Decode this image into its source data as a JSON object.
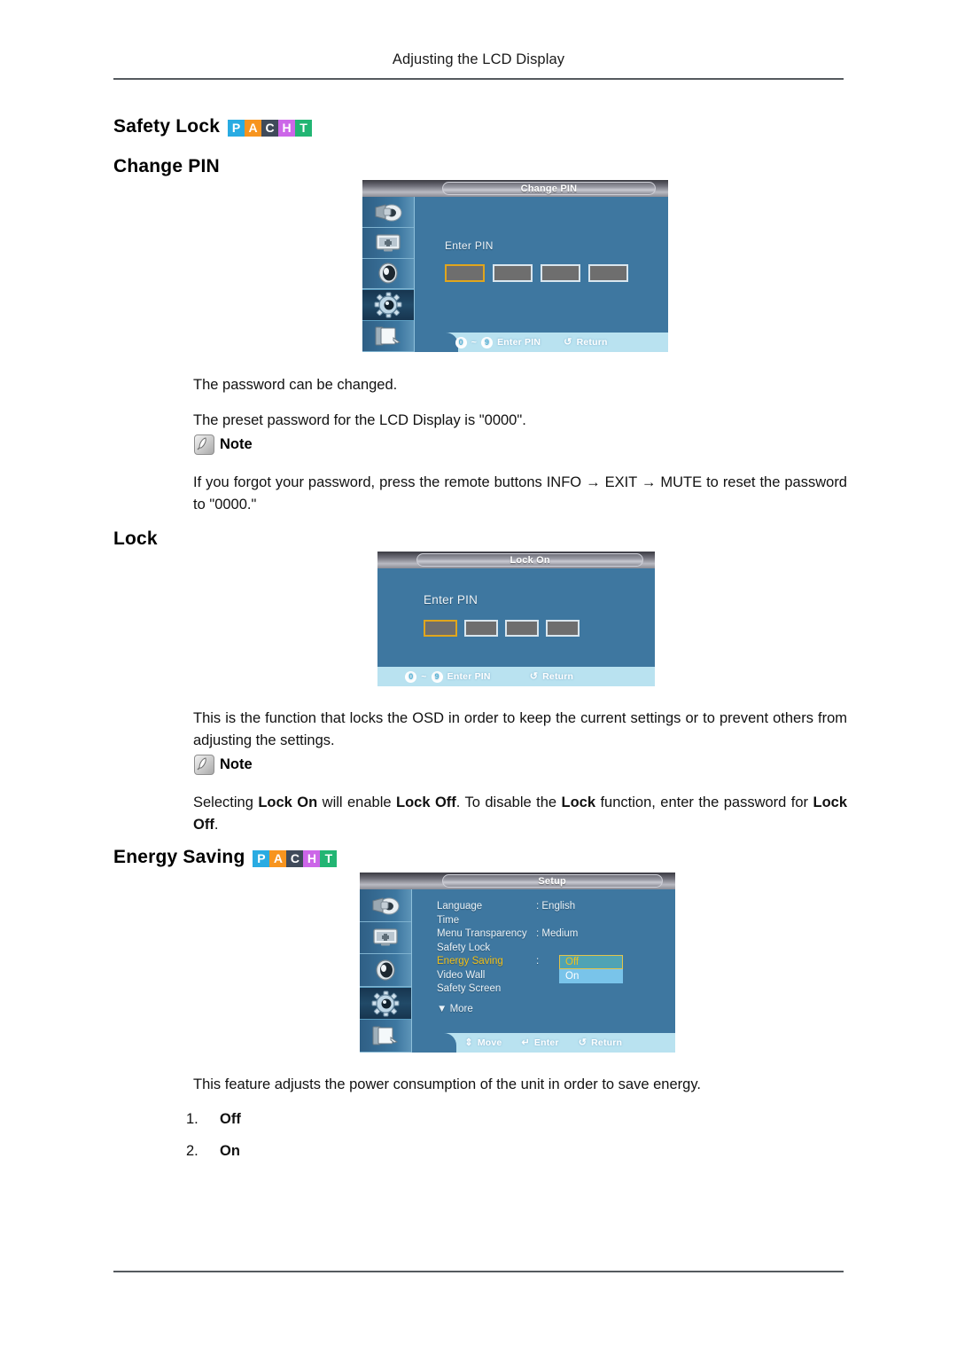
{
  "header": {
    "running_title": "Adjusting the LCD Display"
  },
  "badge": {
    "letters": [
      {
        "char": "P",
        "color": "#29abe2"
      },
      {
        "char": "A",
        "color": "#f7941e"
      },
      {
        "char": "C",
        "color": "#3f4a5a"
      },
      {
        "char": "H",
        "color": "#cc66e8"
      },
      {
        "char": "T",
        "color": "#22b573"
      }
    ]
  },
  "sections": {
    "safety_lock": {
      "title": "Safety Lock",
      "sub_title": "Change PIN",
      "paragraphs": [
        "The password can be changed.",
        "The preset password for the LCD Display is \"0000\"."
      ],
      "note_label": "Note",
      "note_text": "If you forgot your password, press the remote buttons INFO → EXIT → MUTE to reset the password to \"0000.\""
    },
    "lock": {
      "title": "Lock",
      "paragraph": "This is the function that locks the OSD in order to keep the current settings or to prevent others from adjusting the settings.",
      "note_label": "Note",
      "note_parts": [
        {
          "text": "Selecting ",
          "bold": false
        },
        {
          "text": "Lock On",
          "bold": true
        },
        {
          "text": " will enable ",
          "bold": false
        },
        {
          "text": "Lock Off",
          "bold": true
        },
        {
          "text": ". To disable the ",
          "bold": false
        },
        {
          "text": "Lock",
          "bold": true
        },
        {
          "text": " function, enter the password for ",
          "bold": false
        },
        {
          "text": "Lock Off",
          "bold": true
        },
        {
          "text": ".",
          "bold": false
        }
      ]
    },
    "energy_saving": {
      "title": "Energy Saving",
      "paragraph": "This feature adjusts the power consumption of the unit in order to save energy.",
      "options": [
        {
          "num": "1.",
          "label": "Off"
        },
        {
          "num": "2.",
          "label": "On"
        }
      ]
    }
  },
  "osd_change_pin": {
    "title": "Change PIN",
    "pin_label": "Enter PIN",
    "pin_box_count": 4,
    "active_box_index": 0,
    "sidebar_icons": [
      "input-source-icon",
      "picture-icon",
      "sound-icon",
      "setup-gear-icon",
      "multi-control-icon"
    ],
    "active_sidebar_index": 3,
    "footer": [
      {
        "keys": [
          "0",
          "9"
        ],
        "separator": "~",
        "label": "Enter PIN"
      },
      {
        "glyph": "↺",
        "label": "Return"
      }
    ]
  },
  "osd_lock_on": {
    "title": "Lock On",
    "pin_label": "Enter PIN",
    "pin_box_count": 4,
    "active_box_index": 0,
    "footer": [
      {
        "keys": [
          "0",
          "9"
        ],
        "separator": "~",
        "label": "Enter PIN"
      },
      {
        "glyph": "↺",
        "label": "Return"
      }
    ]
  },
  "osd_setup": {
    "title": "Setup",
    "sidebar_icons": [
      "input-source-icon",
      "picture-icon",
      "sound-icon",
      "setup-gear-icon",
      "multi-control-icon"
    ],
    "active_sidebar_index": 3,
    "menu_rows": [
      {
        "name": "Language",
        "value": ": English",
        "selected": false
      },
      {
        "name": "Time",
        "value": "",
        "selected": false
      },
      {
        "name": "Menu Transparency",
        "value": ": Medium",
        "selected": false
      },
      {
        "name": "Safety Lock",
        "value": "",
        "selected": false
      },
      {
        "name": "Energy Saving",
        "value": ":",
        "selected": true
      },
      {
        "name": "Video Wall",
        "value": "",
        "selected": false
      },
      {
        "name": "Safety Screen",
        "value": "",
        "selected": false
      }
    ],
    "more_label": "▼ More",
    "dropdown": {
      "selected": "Off",
      "other": "On"
    },
    "footer": [
      {
        "glyph": "⇕",
        "label": "Move"
      },
      {
        "glyph": "↵",
        "label": "Enter"
      },
      {
        "glyph": "↺",
        "label": "Return"
      }
    ]
  }
}
